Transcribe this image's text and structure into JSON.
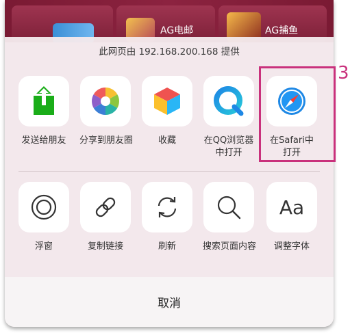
{
  "background": {
    "games": [
      {
        "label": ""
      },
      {
        "label": "AG电邮"
      },
      {
        "label": "AG捕鱼"
      }
    ]
  },
  "sheet": {
    "provider_text": "此网页由 192.168.200.168 提供",
    "row1": [
      {
        "icon": "share-up-arrow-icon",
        "label": "发送给朋友"
      },
      {
        "icon": "aperture-icon",
        "label": "分享到朋友圈"
      },
      {
        "icon": "cube-icon",
        "label": "收藏"
      },
      {
        "icon": "qq-browser-icon",
        "label": "在QQ浏览器\n中打开"
      },
      {
        "icon": "safari-compass-icon",
        "label": "在Safari中\n打开"
      }
    ],
    "row2": [
      {
        "icon": "floating-window-icon",
        "label": "浮窗"
      },
      {
        "icon": "link-icon",
        "label": "复制链接"
      },
      {
        "icon": "refresh-icon",
        "label": "刷新"
      },
      {
        "icon": "search-icon",
        "label": "搜索页面内容"
      },
      {
        "icon": "font-size-icon",
        "label": "调整字体",
        "glyph": "Aa"
      }
    ],
    "cancel_label": "取消"
  },
  "annotation": {
    "step_number": "3",
    "highlight_color": "#c9317c"
  },
  "colors": {
    "share_green": "#1aad19",
    "sheet_bg": "#f3e8eb"
  }
}
